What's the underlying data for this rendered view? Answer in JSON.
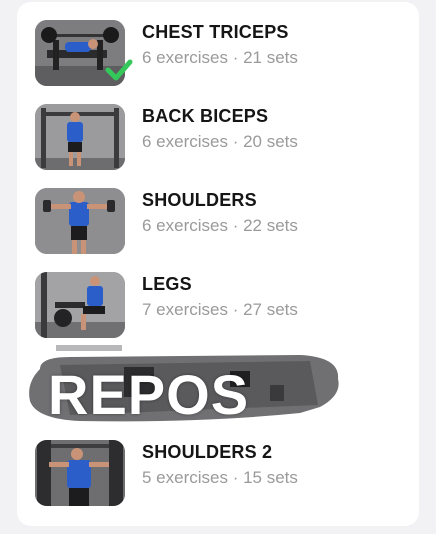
{
  "workouts": [
    {
      "title": "CHEST TRICEPS",
      "meta": "6 exercises · 21 sets",
      "completed": true,
      "image": "bench-press-photo"
    },
    {
      "title": "BACK BICEPS",
      "meta": "6 exercises · 20 sets",
      "completed": false,
      "image": "pull-up-photo"
    },
    {
      "title": "SHOULDERS",
      "meta": "6 exercises · 22 sets",
      "completed": false,
      "image": "dumbbell-press-photo"
    },
    {
      "title": "LEGS",
      "meta": "7 exercises · 27 sets",
      "completed": false,
      "image": "leg-machine-photo"
    },
    {
      "title": "SHOULDERS 2",
      "meta": "5 exercises · 15 sets",
      "completed": false,
      "image": "cable-machine-photo"
    }
  ],
  "rest_day": {
    "label": "REPOS"
  },
  "colors": {
    "check": "#34c759",
    "title": "#151515",
    "meta": "#9a9a9a",
    "card": "#ffffff",
    "background": "#f2f2f5"
  }
}
